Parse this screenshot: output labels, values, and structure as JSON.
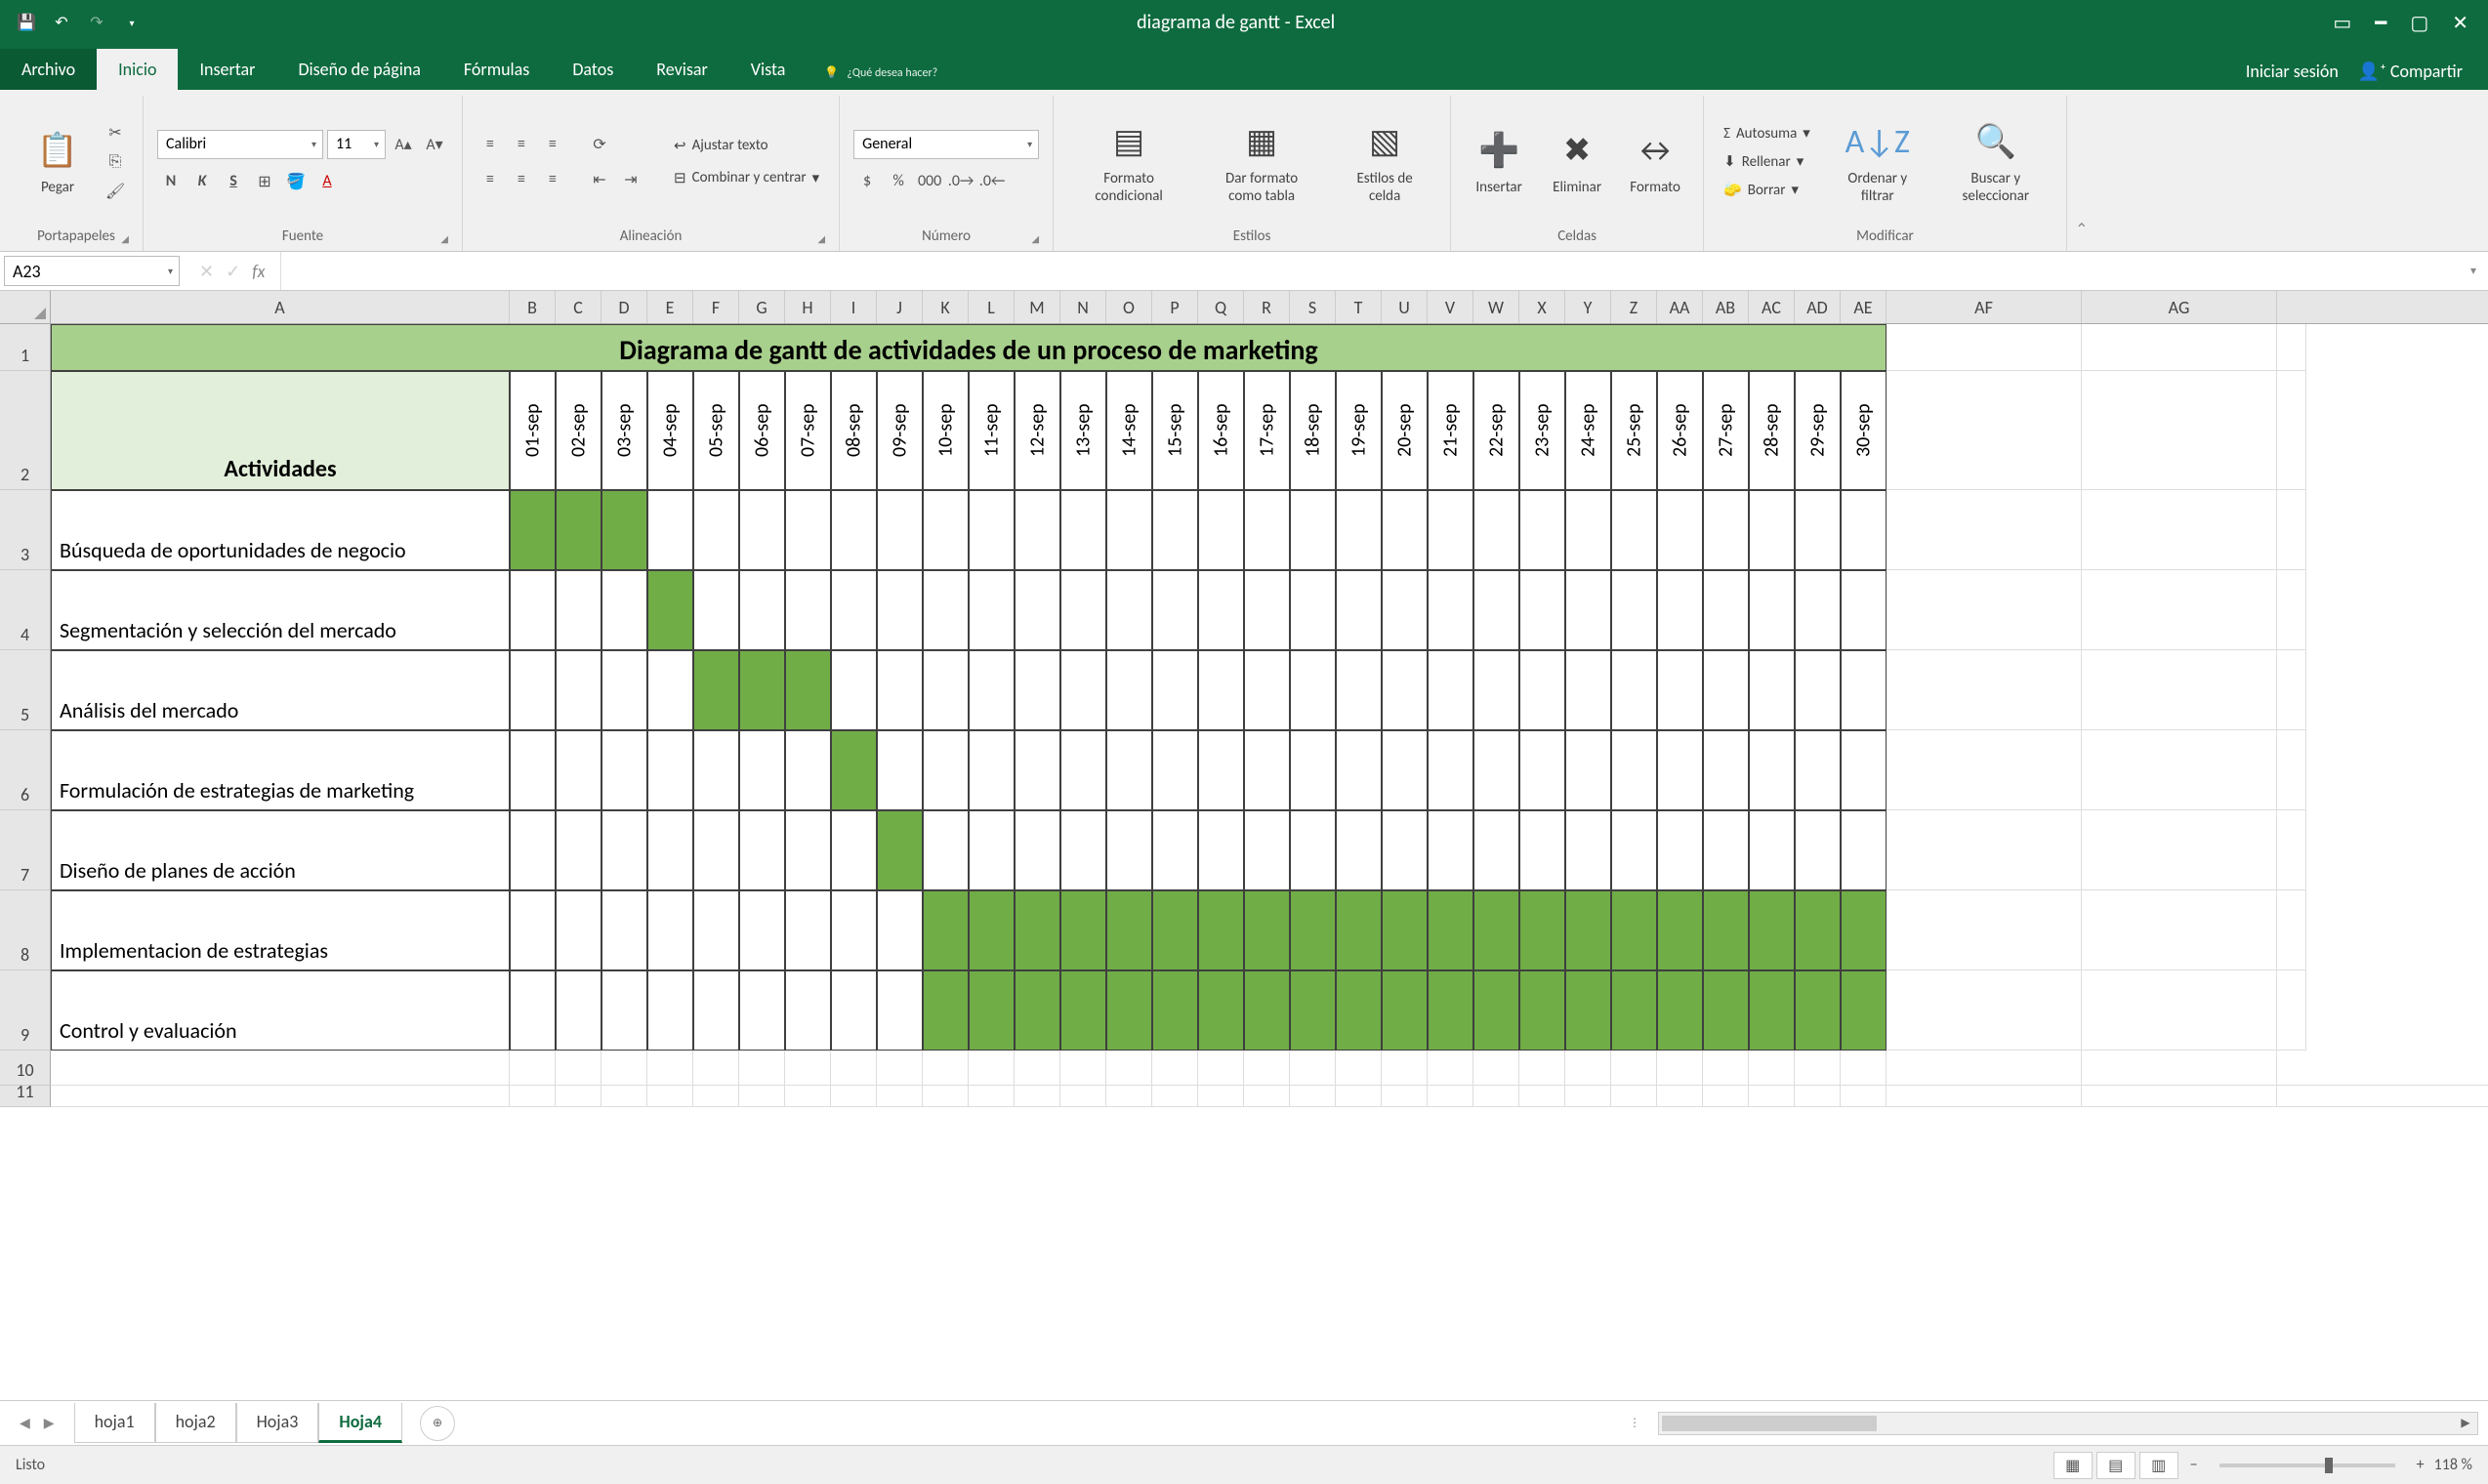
{
  "app": {
    "title": "diagrama de gantt - Excel"
  },
  "qat": {
    "save": "save-icon",
    "undo": "undo-icon",
    "redo": "redo-icon"
  },
  "window": {
    "signin": "Iniciar sesión",
    "share": "Compartir"
  },
  "tabs": {
    "file": "Archivo",
    "home": "Inicio",
    "insert": "Insertar",
    "pagelayout": "Diseño de página",
    "formulas": "Fórmulas",
    "data": "Datos",
    "review": "Revisar",
    "view": "Vista",
    "tellme": "¿Qué desea hacer?"
  },
  "ribbon": {
    "clipboard": {
      "label": "Portapapeles",
      "paste": "Pegar"
    },
    "font": {
      "label": "Fuente",
      "name": "Calibri",
      "size": "11",
      "bold": "N",
      "italic": "K",
      "underline": "S"
    },
    "alignment": {
      "label": "Alineación",
      "wrap": "Ajustar texto",
      "merge": "Combinar y centrar"
    },
    "number": {
      "label": "Número",
      "format": "General"
    },
    "styles": {
      "label": "Estilos",
      "cond": "Formato condicional",
      "table": "Dar formato como tabla",
      "cell": "Estilos de celda"
    },
    "cells": {
      "label": "Celdas",
      "insert": "Insertar",
      "delete": "Eliminar",
      "format": "Formato"
    },
    "editing": {
      "label": "Modificar",
      "sum": "Autosuma",
      "fill": "Rellenar",
      "clear": "Borrar",
      "sort": "Ordenar y filtrar",
      "find": "Buscar y seleccionar"
    }
  },
  "namebox": "A23",
  "columns": [
    "A",
    "B",
    "C",
    "D",
    "E",
    "F",
    "G",
    "H",
    "I",
    "J",
    "K",
    "L",
    "M",
    "N",
    "O",
    "P",
    "Q",
    "R",
    "S",
    "T",
    "U",
    "V",
    "W",
    "X",
    "Y",
    "Z",
    "AA",
    "AB",
    "AC",
    "AD",
    "AE",
    "AF",
    "AG",
    "A"
  ],
  "colWidths": {
    "A": 470,
    "narrow": 47,
    "AF": 200,
    "AG": 200,
    "last": 30
  },
  "rowHeads": [
    "1",
    "2",
    "3",
    "4",
    "5",
    "6",
    "7",
    "8",
    "9",
    "10",
    "11"
  ],
  "chart_data": {
    "type": "gantt",
    "title": "Diagrama de gantt de actividades de un proceso de marketing",
    "xlabel_header": "Actividades",
    "dates": [
      "01-sep",
      "02-sep",
      "03-sep",
      "04-sep",
      "05-sep",
      "06-sep",
      "07-sep",
      "08-sep",
      "09-sep",
      "10-sep",
      "11-sep",
      "12-sep",
      "13-sep",
      "14-sep",
      "15-sep",
      "16-sep",
      "17-sep",
      "18-sep",
      "19-sep",
      "20-sep",
      "21-sep",
      "22-sep",
      "23-sep",
      "24-sep",
      "25-sep",
      "26-sep",
      "27-sep",
      "28-sep",
      "29-sep",
      "30-sep"
    ],
    "activities": [
      {
        "name": "Búsqueda de oportunidades de negocio",
        "start": 1,
        "end": 3
      },
      {
        "name": "Segmentación y selección del mercado",
        "start": 4,
        "end": 4
      },
      {
        "name": "Análisis del mercado",
        "start": 5,
        "end": 7
      },
      {
        "name": "Formulación de estrategias de marketing",
        "start": 8,
        "end": 8
      },
      {
        "name": "Diseño de planes de acción",
        "start": 9,
        "end": 9
      },
      {
        "name": "Implementacion de estrategias",
        "start": 10,
        "end": 30
      },
      {
        "name": "Control y evaluación",
        "start": 10,
        "end": 30
      }
    ]
  },
  "sheets": {
    "tabs": [
      "hoja1",
      "hoja2",
      "Hoja3",
      "Hoja4"
    ],
    "active": 3
  },
  "status": {
    "ready": "Listo",
    "zoom": "118 %"
  }
}
